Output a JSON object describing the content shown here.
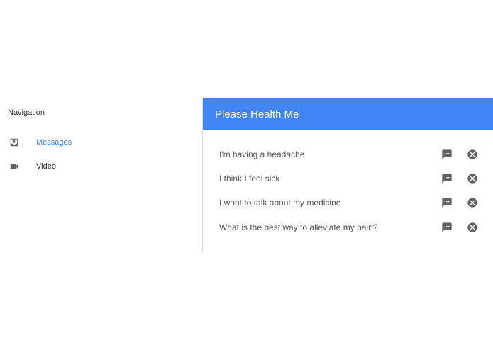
{
  "nav": {
    "title": "Navigation",
    "items": [
      {
        "label": "Messages",
        "icon": "inbox-icon",
        "active": true
      },
      {
        "label": "Video",
        "icon": "videocam-icon",
        "active": false
      }
    ]
  },
  "panel": {
    "title": "Please Health Me",
    "messages": [
      {
        "text": "I'm having a headache"
      },
      {
        "text": "I think I feel sick"
      },
      {
        "text": "I want to talk about my medicine"
      },
      {
        "text": "What is the best way to alleviate my pain?"
      }
    ]
  },
  "colors": {
    "accent": "#4285f4",
    "icon": "#616161"
  }
}
